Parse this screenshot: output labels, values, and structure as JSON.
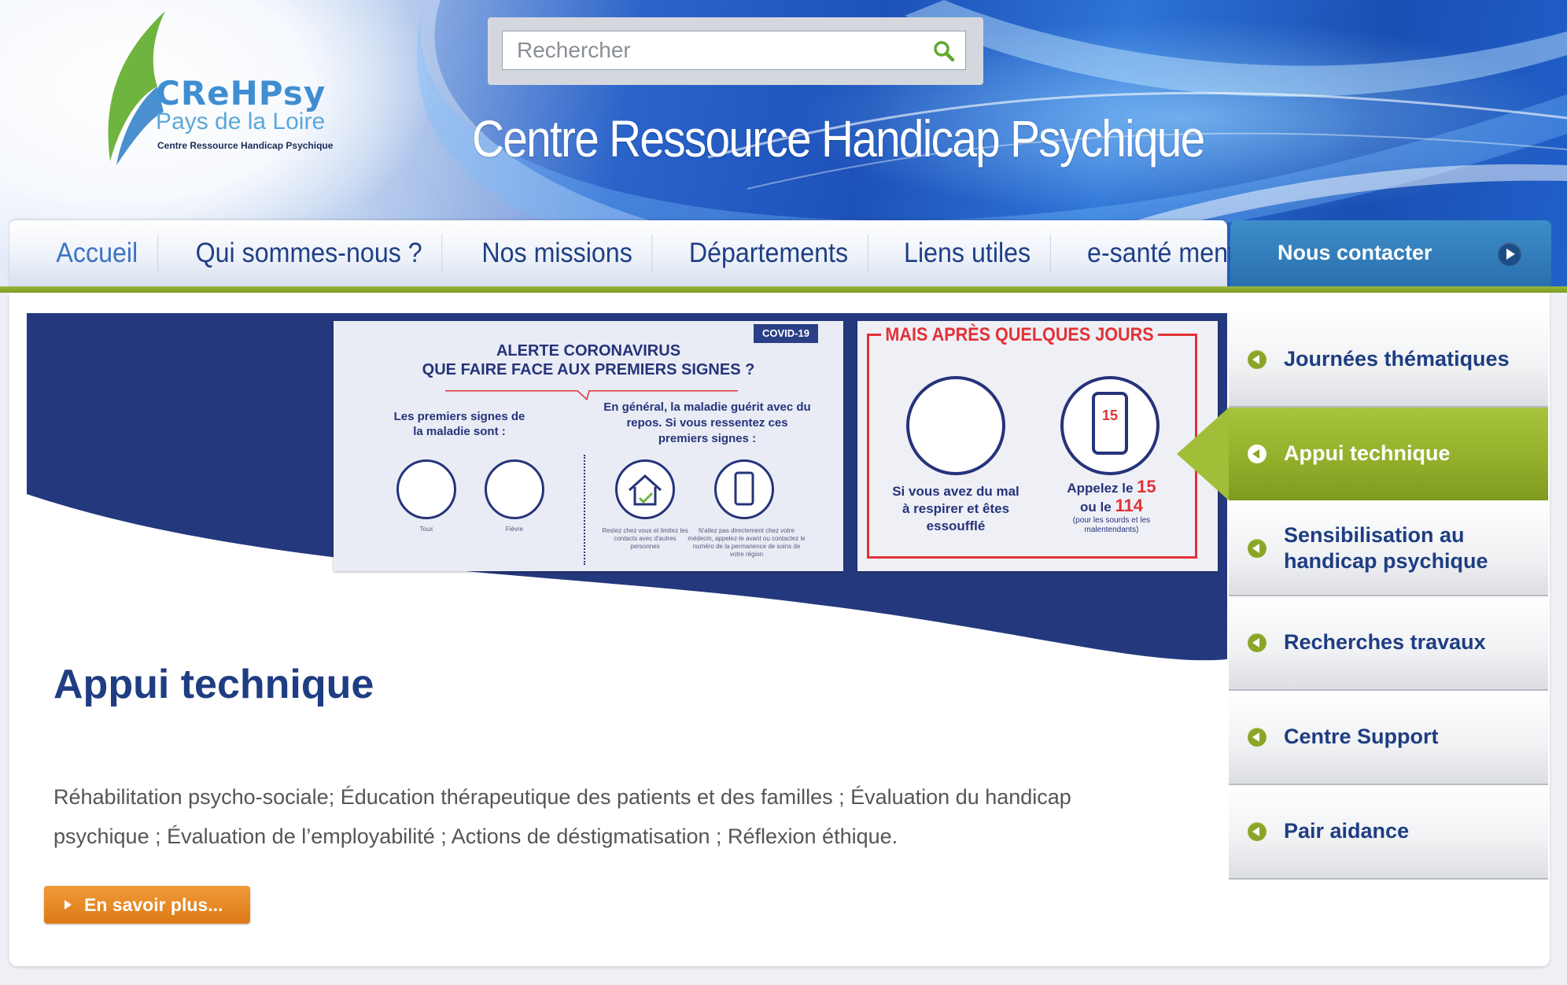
{
  "header": {
    "logo": {
      "word": "CReHPsy",
      "region": "Pays de la Loire",
      "subtitle": "Centre Ressource Handicap Psychique"
    },
    "search": {
      "placeholder": "Rechercher",
      "icon": "search-icon"
    },
    "site_title": "Centre Ressource Handicap Psychique"
  },
  "nav": {
    "items": [
      {
        "label": "Accueil"
      },
      {
        "label": "Qui sommes-nous ?"
      },
      {
        "label": "Nos missions"
      },
      {
        "label": "Départements"
      },
      {
        "label": "Liens utiles"
      },
      {
        "label": "e-santé mentale"
      }
    ],
    "contact_label": "Nous contacter"
  },
  "hero": {
    "poster1": {
      "tag": "COVID-19",
      "title_line1": "ALERTE CORONAVIRUS",
      "title_line2": "QUE FAIRE FACE AUX PREMIERS SIGNES ?",
      "left_text": "Les premiers signes de la maladie sont :",
      "right_text": "En général, la maladie guérit avec du repos. Si vous ressentez ces premiers signes :",
      "caption1": "Toux",
      "caption2": "Fièvre",
      "caption3": "Restez chez vous et limitez les contacts avec d'autres personnes",
      "caption4": "N'allez pas directement chez votre médecin, appelez-le avant ou contactez le numéro de la permanence de soins de votre région"
    },
    "poster2": {
      "title": "MAIS APRÈS QUELQUES JOURS",
      "phone_number": "15",
      "left_caption": "Si vous avez du mal à respirer et êtes essoufflé",
      "right_caption_a": "Appelez le",
      "right_num_a": "15",
      "right_caption_b": "ou le",
      "right_num_b": "114",
      "right_small": "(pour les sourds et les malentendants)"
    }
  },
  "content": {
    "title": "Appui technique",
    "description": "Réhabilitation psycho-sociale; Éducation thérapeutique des patients et des familles ; Évaluation du handicap psychique ; Évaluation de l’employabilité ; Actions de déstigmatisation ; Réflexion éthique.",
    "more_button": "En savoir plus..."
  },
  "sidebar": {
    "items": [
      {
        "label": "Journées thématiques",
        "active": false
      },
      {
        "label": "Appui technique",
        "active": true
      },
      {
        "label": "Sensibilisation au handicap psychique",
        "active": false
      },
      {
        "label": "Recherches travaux",
        "active": false
      },
      {
        "label": "Centre Support",
        "active": false
      },
      {
        "label": "Pair aidance",
        "active": false
      }
    ]
  },
  "colors": {
    "brand_blue": "#1f3d82",
    "accent_green": "#8aa626",
    "button_orange": "#e4861f",
    "alert_red": "#e23237"
  }
}
